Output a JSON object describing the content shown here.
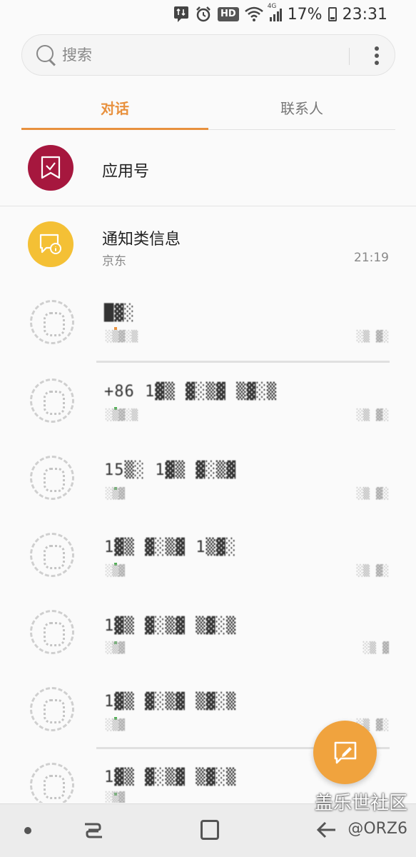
{
  "status_bar": {
    "hd_label": "HD",
    "network_label": "4G",
    "battery_percent": "17%",
    "time": "23:31"
  },
  "search": {
    "placeholder": "搜索"
  },
  "tabs": [
    {
      "label": "对话",
      "active": true
    },
    {
      "label": "联系人",
      "active": false
    }
  ],
  "conversations": {
    "app_account": {
      "title": "应用号"
    },
    "notifications": {
      "title": "通知类信息",
      "sender": "京东",
      "time": "21:19"
    }
  },
  "blurred_contacts": [
    {
      "title": "█▓░",
      "sub": "░▒▓░▒",
      "time": "░▒ ▓░"
    },
    {
      "title": "+86 1▓▒ ▓░▒▓ ▒▓░▒",
      "sub": "░▒▓░▒",
      "time": "░▒ ▓░"
    },
    {
      "title": "15▒░ 1▓▒ ▓░▒▓",
      "sub": "░▒▓",
      "time": "░▒ ▓░"
    },
    {
      "title": "1▓▒ ▓░▒▓ 1▒▓░",
      "sub": "░▒▓",
      "time": "░▒ ▓░"
    },
    {
      "title": "1▓▒ ▓░▒▓ ▒▓░▒",
      "sub": "░▒▓",
      "time": "░▒ ▓"
    },
    {
      "title": "1▓▒ ▓░▒▓ ▒▓░▒",
      "sub": "░▒▓",
      "time": "░▒ ▓░"
    },
    {
      "title": "1▓▒ ▓░▒▓ ▒▓░▒",
      "sub": "░▒▓",
      "time": ""
    }
  ],
  "watermark": {
    "site": "盖乐世社区",
    "user": "@ORZ6"
  },
  "colors": {
    "accent": "#e8913e",
    "app_avatar": "#a6173e",
    "notice_avatar": "#f4c035",
    "fab": "#f0a33e"
  },
  "icons": {
    "app_avatar": "bookmark-check-icon",
    "notice_avatar": "chat-info-icon",
    "fab": "compose-message-icon",
    "search": "search-icon",
    "more": "more-vertical-icon"
  }
}
